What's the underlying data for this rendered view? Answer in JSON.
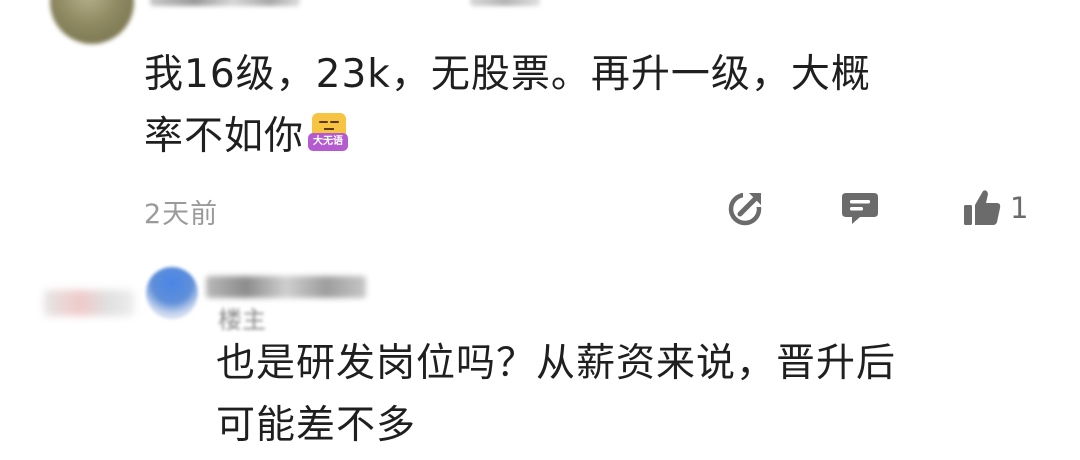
{
  "comment": {
    "text_line1": "我16级，23k，无股票。再升一级，大概",
    "text_line2": "率不如你",
    "sticker_label": "大无语",
    "timestamp": "2天前",
    "like_count": "1",
    "icons": {
      "share": "share-edit-icon",
      "reply": "comment-bubble-icon",
      "like": "thumbs-up-icon"
    }
  },
  "reply": {
    "op_tag": "楼主",
    "text_line1": "也是研发岗位吗？从薪资来说，晋升后",
    "text_line2": "可能差不多"
  },
  "colors": {
    "text": "#1f1f1f",
    "meta": "#9a9a9a",
    "icon": "#6b6b6b",
    "reply_avatar": "#4a86e6",
    "sticker_label_bg": "#b45bd0"
  }
}
